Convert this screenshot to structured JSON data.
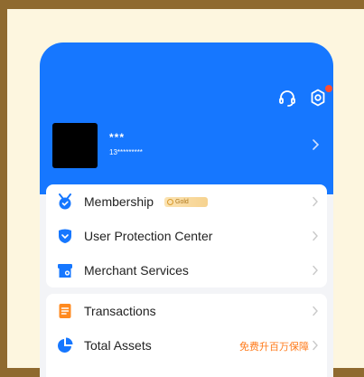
{
  "header": {
    "icons": [
      "headset-icon",
      "settings-icon"
    ],
    "accent_color": "#1677ff",
    "notification_dot_color": "#ff4d2e"
  },
  "profile": {
    "name": "***",
    "phone": "13*********"
  },
  "menu_group_1": [
    {
      "label": "Membership",
      "icon": "medal-icon",
      "badge": "Gold"
    },
    {
      "label": "User Protection Center",
      "icon": "shield-icon"
    },
    {
      "label": "Merchant Services",
      "icon": "store-icon"
    }
  ],
  "menu_group_2": [
    {
      "label": "Transactions",
      "icon": "document-icon"
    },
    {
      "label": "Total Assets",
      "icon": "pie-chart-icon",
      "promo": "免费升百万保障"
    }
  ]
}
